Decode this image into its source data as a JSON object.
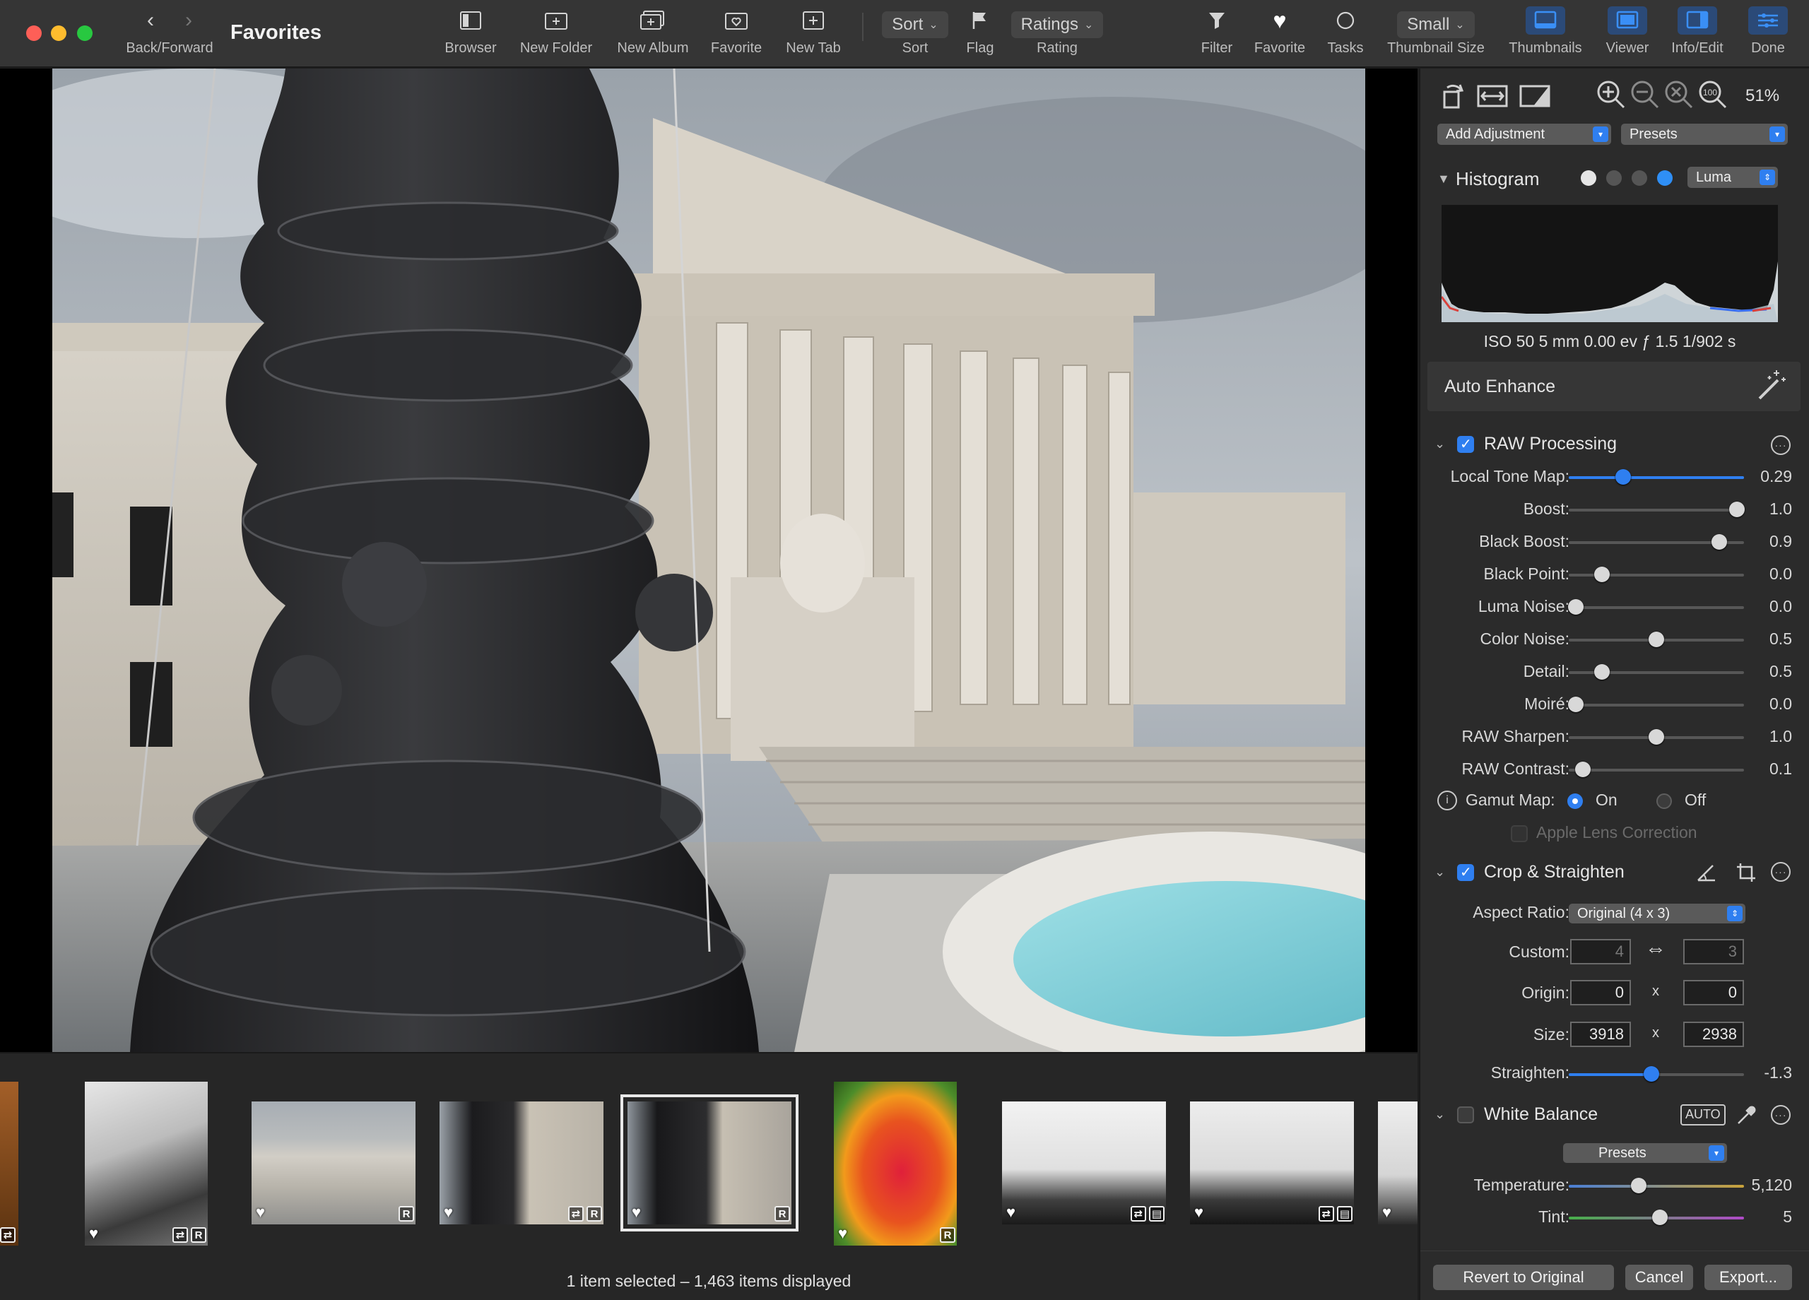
{
  "window": {
    "title": "Favorites"
  },
  "toolbar": {
    "back_forward": "Back/Forward",
    "browser": "Browser",
    "new_folder": "New Folder",
    "new_album": "New Album",
    "favorite": "Favorite",
    "new_tab": "New Tab",
    "sort_value": "Sort",
    "sort": "Sort",
    "flag": "Flag",
    "rating_value": "Ratings",
    "rating": "Rating",
    "filter": "Filter",
    "favorite2": "Favorite",
    "tasks": "Tasks",
    "thumb_size_value": "Small",
    "thumb_size": "Thumbnail Size",
    "thumbnails": "Thumbnails",
    "viewer": "Viewer",
    "info_edit": "Info/Edit",
    "done": "Done"
  },
  "panel": {
    "zoom": "51%",
    "add_adjustment": "Add Adjustment",
    "presets": "Presets",
    "histogram": {
      "title": "Histogram",
      "mode": "Luma",
      "exif": "ISO 50   5 mm   0.00 ev   ƒ 1.5   1/902 s"
    },
    "auto_enhance": "Auto Enhance",
    "raw": {
      "title": "RAW Processing",
      "sliders": [
        {
          "label": "Local Tone Map:",
          "value": "0.29",
          "pos": 0.31,
          "blue": true
        },
        {
          "label": "Boost:",
          "value": "1.0",
          "pos": 0.96,
          "blue": false
        },
        {
          "label": "Black Boost:",
          "value": "0.9",
          "pos": 0.86,
          "blue": false
        },
        {
          "label": "Black Point:",
          "value": "0.0",
          "pos": 0.19,
          "blue": false
        },
        {
          "label": "Luma Noise:",
          "value": "0.0",
          "pos": 0.04,
          "blue": false
        },
        {
          "label": "Color Noise:",
          "value": "0.5",
          "pos": 0.5,
          "blue": false
        },
        {
          "label": "Detail:",
          "value": "0.5",
          "pos": 0.19,
          "blue": false
        },
        {
          "label": "Moiré:",
          "value": "0.0",
          "pos": 0.04,
          "blue": false
        },
        {
          "label": "RAW Sharpen:",
          "value": "1.0",
          "pos": 0.5,
          "blue": false
        },
        {
          "label": "RAW Contrast:",
          "value": "0.1",
          "pos": 0.08,
          "blue": false
        }
      ],
      "gamut_label": "Gamut Map:",
      "gamut_on": "On",
      "gamut_off": "Off",
      "lens_correction": "Apple Lens Correction"
    },
    "crop": {
      "title": "Crop & Straighten",
      "aspect_label": "Aspect Ratio:",
      "aspect_value": "Original (4 x 3)",
      "custom_label": "Custom:",
      "custom_w": "4",
      "custom_h": "3",
      "origin_label": "Origin:",
      "origin_x": "0",
      "origin_y": "0",
      "size_label": "Size:",
      "size_w": "3918",
      "size_h": "2938",
      "x": "x",
      "straighten_label": "Straighten:",
      "straighten_value": "-1.3",
      "straighten_pos": 0.47
    },
    "wb": {
      "title": "White Balance",
      "auto": "AUTO",
      "presets": "Presets",
      "temp_label": "Temperature:",
      "temp_value": "5,120",
      "temp_pos": 0.4,
      "tint_label": "Tint:",
      "tint_value": "5",
      "tint_pos": 0.52
    },
    "buttons": {
      "revert": "Revert to Original",
      "cancel": "Cancel",
      "export": "Export..."
    }
  },
  "filmstrip": {
    "status": "1 item selected – 1,463 items displayed",
    "badge_r": "R"
  },
  "colors": {
    "accent": "#2f7ff0"
  }
}
